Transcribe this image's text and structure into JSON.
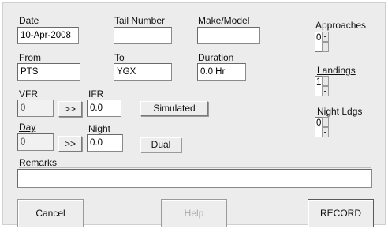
{
  "labels": {
    "date": "Date",
    "tail_number": "Tail Number",
    "make_model": "Make/Model",
    "approaches": "Approaches",
    "from": "From",
    "to": "To",
    "duration": "Duration",
    "landings": "Landings",
    "vfr": "VFR",
    "ifr": "IFR",
    "night_ldgs": "Night Ldgs",
    "day": "Day",
    "night": "Night",
    "remarks": "Remarks"
  },
  "fields": {
    "date": "10-Apr-2008",
    "tail_number": "",
    "make_model": "",
    "from": "PTS",
    "to": "YGX",
    "duration": "0.0 Hr",
    "vfr": "0",
    "ifr": "0.0",
    "day": "0",
    "night": "0.0",
    "approaches": "0",
    "landings": "1",
    "night_ldgs": "0",
    "remarks": ""
  },
  "buttons": {
    "vfr_transfer": ">>",
    "day_transfer": ">>",
    "simulated": "Simulated",
    "dual": "Dual",
    "cancel": "Cancel",
    "help": "Help",
    "record": "RECORD"
  }
}
